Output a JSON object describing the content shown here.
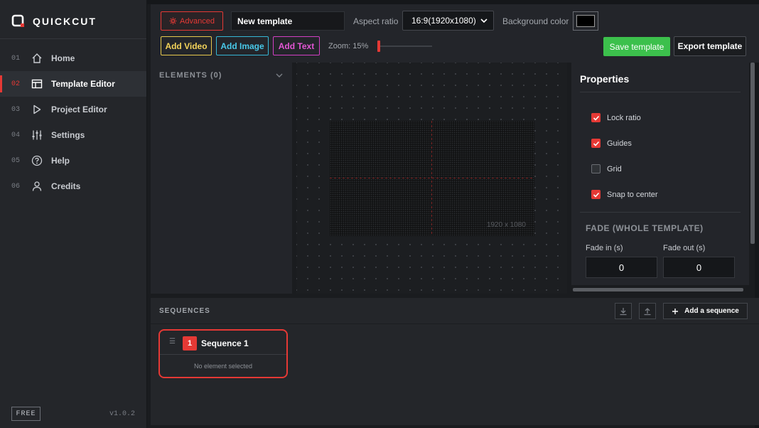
{
  "app": {
    "name": "QUICKCUT",
    "version": "v1.0.2",
    "plan_badge": "FREE"
  },
  "sidebar": {
    "items": [
      {
        "num": "01",
        "label": "Home",
        "icon": "home-icon",
        "active": false
      },
      {
        "num": "02",
        "label": "Template Editor",
        "icon": "layout-icon",
        "active": true
      },
      {
        "num": "03",
        "label": "Project Editor",
        "icon": "play-icon",
        "active": false
      },
      {
        "num": "04",
        "label": "Settings",
        "icon": "sliders-icon",
        "active": false
      },
      {
        "num": "05",
        "label": "Help",
        "icon": "help-icon",
        "active": false
      },
      {
        "num": "06",
        "label": "Credits",
        "icon": "user-icon",
        "active": false
      }
    ]
  },
  "toolbar": {
    "advanced_label": "Advanced",
    "template_name": "New template",
    "aspect_label": "Aspect ratio",
    "aspect_value": "16:9(1920x1080)",
    "bg_label": "Background color",
    "bg_color": "#000000",
    "add_video": "Add Video",
    "add_image": "Add Image",
    "add_text": "Add Text",
    "zoom_label": "Zoom: 15%",
    "zoom_level": 0.15,
    "save_label": "Save template",
    "export_label": "Export template"
  },
  "elements": {
    "title": "ELEMENTS (0)"
  },
  "canvas": {
    "size_label": "1920 x 1080"
  },
  "properties": {
    "title": "Properties",
    "options": [
      {
        "label": "Lock ratio",
        "checked": true
      },
      {
        "label": "Guides",
        "checked": true
      },
      {
        "label": "Grid",
        "checked": false
      },
      {
        "label": "Snap to center",
        "checked": true
      }
    ],
    "fade_title": "FADE (WHOLE TEMPLATE)",
    "fade_in_label": "Fade in (s)",
    "fade_in_value": "0",
    "fade_out_label": "Fade out (s)",
    "fade_out_value": "0"
  },
  "sequences": {
    "title": "SEQUENCES",
    "add_label": "Add a sequence",
    "items": [
      {
        "num": "1",
        "name": "Sequence 1",
        "status": "No element selected"
      }
    ]
  },
  "colors": {
    "accent": "#e53935",
    "save": "#3cc04c",
    "video": "#f3d35a",
    "image": "#48c8e8",
    "text": "#e356d5"
  }
}
